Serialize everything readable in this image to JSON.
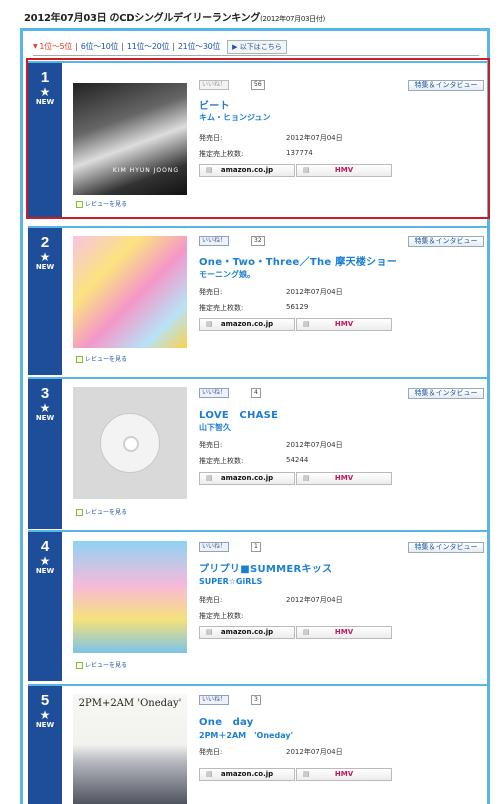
{
  "page": {
    "title": "2012年07月03日 のCDシングルデイリーランキング",
    "title_sub": "(2012年07月03日付)"
  },
  "tabs": {
    "items": [
      {
        "label": "1位～5位",
        "active": true
      },
      {
        "label": "6位～10位",
        "active": false
      },
      {
        "label": "11位～20位",
        "active": false
      },
      {
        "label": "21位～30位",
        "active": false
      }
    ],
    "next_label": "▶ 以下はこちら"
  },
  "labels": {
    "release_date": "発売日:",
    "sales": "推定売上枚数:",
    "feature": "特集＆インタビュー",
    "review": "レビューを見る",
    "new_badge": "NEW",
    "star": "★",
    "like": "いいね！",
    "amazon": "amazon.co.jp",
    "hmv": "HMV",
    "shop_mark": "▤"
  },
  "entries": [
    {
      "rank": "1",
      "title": "ビート",
      "artist": "キム・ヒョンジュン",
      "release_date": "2012年07月04日",
      "sales": "137774",
      "likes": "56",
      "cover_caption": "",
      "cover_overlay": "KIM HYUN JOONG"
    },
    {
      "rank": "2",
      "title": "One・Two・Three／The 摩天楼ショー",
      "artist": "モーニング娘。",
      "release_date": "2012年07月04日",
      "sales": "56129",
      "likes": "32",
      "cover_caption": "",
      "cover_overlay": ""
    },
    {
      "rank": "3",
      "title": "LOVE　CHASE",
      "artist": "山下智久",
      "release_date": "2012年07月04日",
      "sales": "54244",
      "likes": "4",
      "cover_caption": "",
      "cover_overlay": ""
    },
    {
      "rank": "4",
      "title": "プリプリ■SUMMERキッス",
      "artist": "SUPER☆GiRLS",
      "release_date": "2012年07月04日",
      "sales": "",
      "likes": "1",
      "cover_caption": "",
      "cover_overlay": ""
    },
    {
      "rank": "5",
      "title": "One　day",
      "artist": "2PM＋2AM　'Oneday'",
      "release_date": "2012年07月04日",
      "sales": "",
      "likes": "3",
      "cover_caption": "2PM+2AM 'Oneday'",
      "cover_overlay": ""
    }
  ]
}
